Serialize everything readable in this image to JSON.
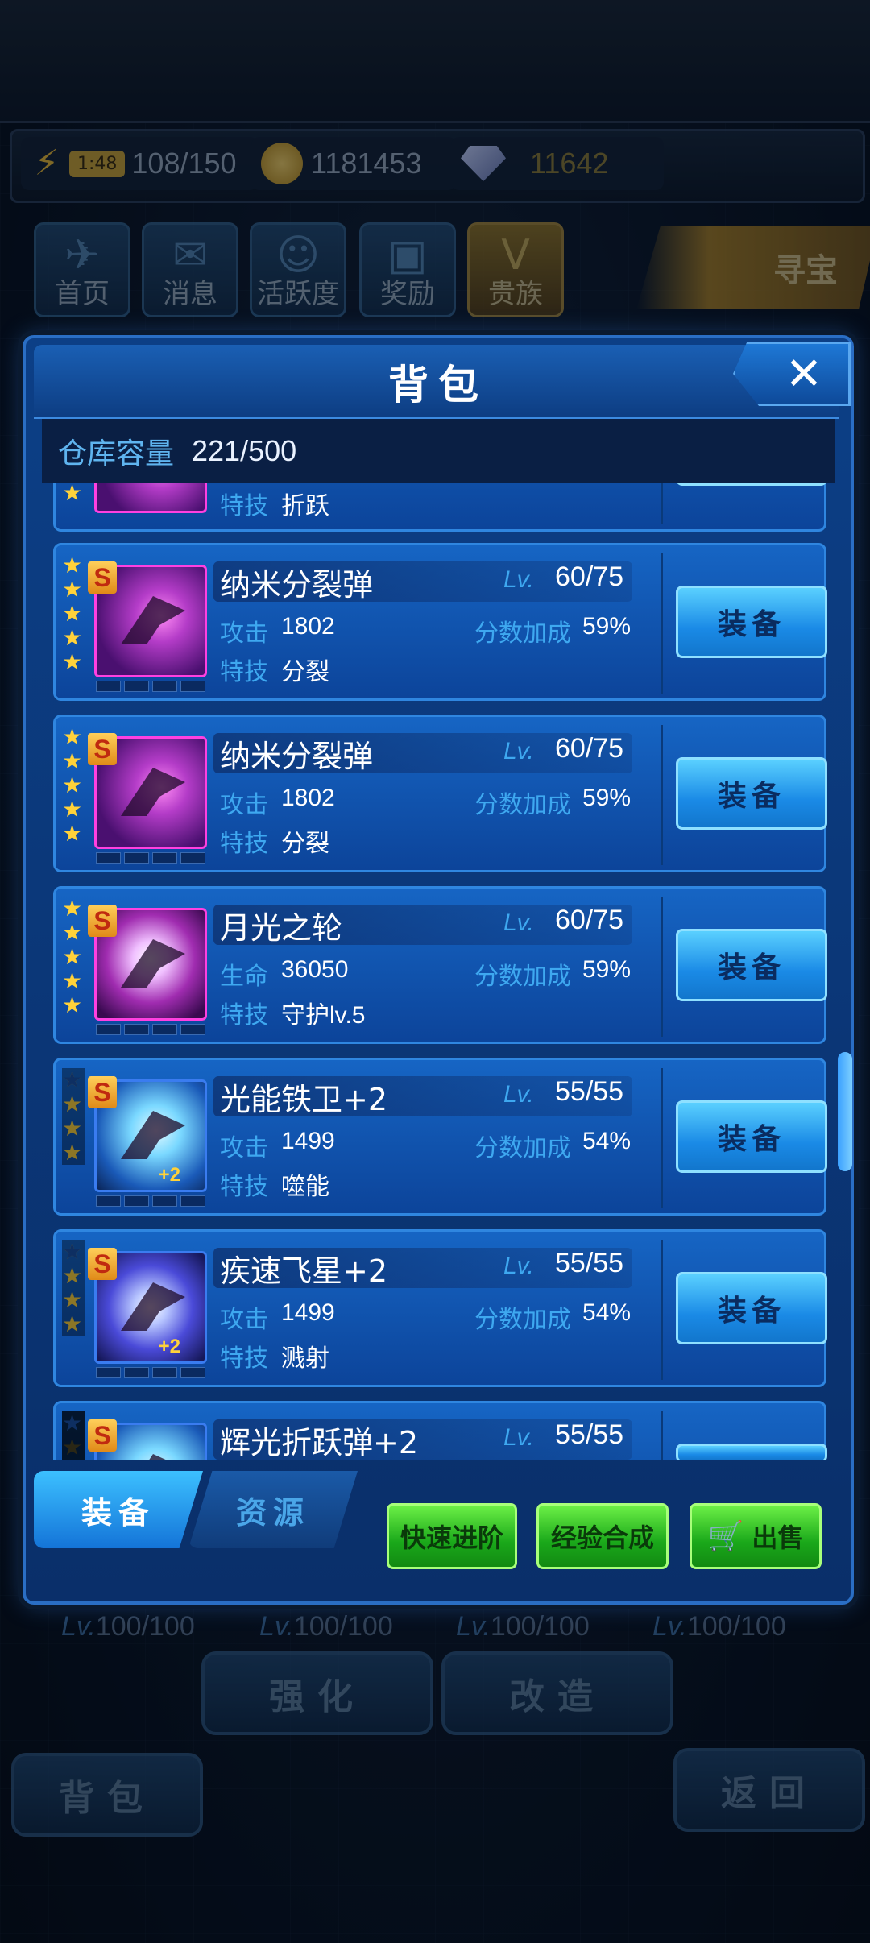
{
  "currency": {
    "energy_timer": "1:48",
    "energy_value": "108/150",
    "coins": "1181453",
    "gems": "11642"
  },
  "top_nav": [
    {
      "label": "首页",
      "icon": "home-jet-icon"
    },
    {
      "label": "消息",
      "icon": "mail-icon"
    },
    {
      "label": "活跃度",
      "icon": "face-badge-icon"
    },
    {
      "label": "奖励",
      "icon": "gift-icon"
    },
    {
      "label": "贵族",
      "icon": "v-crown-icon"
    }
  ],
  "treasure_label": "寻宝",
  "background": {
    "levels": [
      "100/100",
      "100/100",
      "100/100",
      "100/100"
    ],
    "lv_prefix": "Lv.",
    "enhance_label": "强化",
    "modify_label": "改造",
    "bag_label": "背包",
    "back_label": "返回"
  },
  "dialog": {
    "title": "背包",
    "close_icon": "✕",
    "capacity_label": "仓库容量",
    "capacity_value": "221/500",
    "partial_top": {
      "skill_label": "特技",
      "skill_value": "折跃"
    },
    "items": [
      {
        "name": "纳米分裂弹",
        "grade": "S",
        "stars": 5,
        "lv_label": "Lv.",
        "level": "60/75",
        "stat_label": "攻击",
        "stat_value": "1802",
        "bonus_label": "分数加成",
        "bonus_value": "59%",
        "skill_label": "特技",
        "skill_value": "分裂",
        "thumb": "purple",
        "plus": "",
        "button": "装备"
      },
      {
        "name": "纳米分裂弹",
        "grade": "S",
        "stars": 5,
        "lv_label": "Lv.",
        "level": "60/75",
        "stat_label": "攻击",
        "stat_value": "1802",
        "bonus_label": "分数加成",
        "bonus_value": "59%",
        "skill_label": "特技",
        "skill_value": "分裂",
        "thumb": "purple",
        "plus": "",
        "button": "装备"
      },
      {
        "name": "月光之轮",
        "grade": "S",
        "stars": 5,
        "lv_label": "Lv.",
        "level": "60/75",
        "stat_label": "生命",
        "stat_value": "36050",
        "bonus_label": "分数加成",
        "bonus_value": "59%",
        "skill_label": "特技",
        "skill_value": "守护lv.5",
        "thumb": "moon",
        "plus": "",
        "button": "装备"
      },
      {
        "name": "光能铁卫+2",
        "grade": "S",
        "stars": 4,
        "lv_label": "Lv.",
        "level": "55/55",
        "stat_label": "攻击",
        "stat_value": "1499",
        "bonus_label": "分数加成",
        "bonus_value": "54%",
        "skill_label": "特技",
        "skill_value": "噬能",
        "thumb": "blue",
        "plus": "+2",
        "button": "装备"
      },
      {
        "name": "疾速飞星+2",
        "grade": "S",
        "stars": 4,
        "lv_label": "Lv.",
        "level": "55/55",
        "stat_label": "攻击",
        "stat_value": "1499",
        "bonus_label": "分数加成",
        "bonus_value": "54%",
        "skill_label": "特技",
        "skill_value": "溅射",
        "thumb": "violet",
        "plus": "+2",
        "button": "装备"
      },
      {
        "name": "辉光折跃弹+2",
        "grade": "S",
        "stars": 2,
        "lv_label": "Lv.",
        "level": "55/55",
        "stat_label": "",
        "stat_value": "",
        "bonus_label": "",
        "bonus_value": "",
        "skill_label": "",
        "skill_value": "",
        "thumb": "blue",
        "plus": "",
        "button": ""
      }
    ],
    "tabs": [
      {
        "label": "装备",
        "active": true
      },
      {
        "label": "资源",
        "active": false
      }
    ],
    "actions": {
      "quick_advance": "快速进阶",
      "exp_merge": "经验合成",
      "sell": "出售"
    }
  },
  "colors": {
    "accent_blue": "#3ea8f0",
    "star_gold": "#ffd23a",
    "action_green": "#1aa81a"
  }
}
